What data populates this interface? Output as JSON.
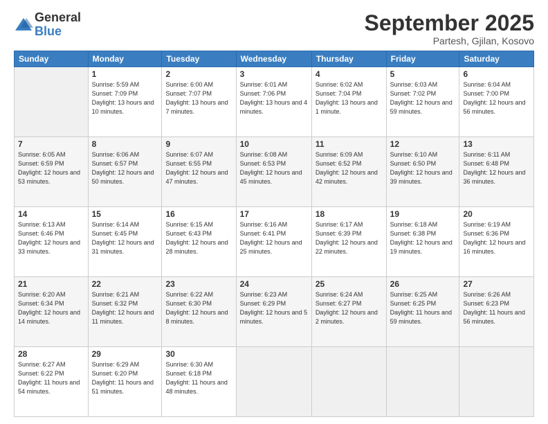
{
  "logo": {
    "general": "General",
    "blue": "Blue"
  },
  "title": "September 2025",
  "location": "Partesh, Gjilan, Kosovo",
  "days_of_week": [
    "Sunday",
    "Monday",
    "Tuesday",
    "Wednesday",
    "Thursday",
    "Friday",
    "Saturday"
  ],
  "weeks": [
    [
      {
        "day": "",
        "sunrise": "",
        "sunset": "",
        "daylight": ""
      },
      {
        "day": "1",
        "sunrise": "Sunrise: 5:59 AM",
        "sunset": "Sunset: 7:09 PM",
        "daylight": "Daylight: 13 hours and 10 minutes."
      },
      {
        "day": "2",
        "sunrise": "Sunrise: 6:00 AM",
        "sunset": "Sunset: 7:07 PM",
        "daylight": "Daylight: 13 hours and 7 minutes."
      },
      {
        "day": "3",
        "sunrise": "Sunrise: 6:01 AM",
        "sunset": "Sunset: 7:06 PM",
        "daylight": "Daylight: 13 hours and 4 minutes."
      },
      {
        "day": "4",
        "sunrise": "Sunrise: 6:02 AM",
        "sunset": "Sunset: 7:04 PM",
        "daylight": "Daylight: 13 hours and 1 minute."
      },
      {
        "day": "5",
        "sunrise": "Sunrise: 6:03 AM",
        "sunset": "Sunset: 7:02 PM",
        "daylight": "Daylight: 12 hours and 59 minutes."
      },
      {
        "day": "6",
        "sunrise": "Sunrise: 6:04 AM",
        "sunset": "Sunset: 7:00 PM",
        "daylight": "Daylight: 12 hours and 56 minutes."
      }
    ],
    [
      {
        "day": "7",
        "sunrise": "Sunrise: 6:05 AM",
        "sunset": "Sunset: 6:59 PM",
        "daylight": "Daylight: 12 hours and 53 minutes."
      },
      {
        "day": "8",
        "sunrise": "Sunrise: 6:06 AM",
        "sunset": "Sunset: 6:57 PM",
        "daylight": "Daylight: 12 hours and 50 minutes."
      },
      {
        "day": "9",
        "sunrise": "Sunrise: 6:07 AM",
        "sunset": "Sunset: 6:55 PM",
        "daylight": "Daylight: 12 hours and 47 minutes."
      },
      {
        "day": "10",
        "sunrise": "Sunrise: 6:08 AM",
        "sunset": "Sunset: 6:53 PM",
        "daylight": "Daylight: 12 hours and 45 minutes."
      },
      {
        "day": "11",
        "sunrise": "Sunrise: 6:09 AM",
        "sunset": "Sunset: 6:52 PM",
        "daylight": "Daylight: 12 hours and 42 minutes."
      },
      {
        "day": "12",
        "sunrise": "Sunrise: 6:10 AM",
        "sunset": "Sunset: 6:50 PM",
        "daylight": "Daylight: 12 hours and 39 minutes."
      },
      {
        "day": "13",
        "sunrise": "Sunrise: 6:11 AM",
        "sunset": "Sunset: 6:48 PM",
        "daylight": "Daylight: 12 hours and 36 minutes."
      }
    ],
    [
      {
        "day": "14",
        "sunrise": "Sunrise: 6:13 AM",
        "sunset": "Sunset: 6:46 PM",
        "daylight": "Daylight: 12 hours and 33 minutes."
      },
      {
        "day": "15",
        "sunrise": "Sunrise: 6:14 AM",
        "sunset": "Sunset: 6:45 PM",
        "daylight": "Daylight: 12 hours and 31 minutes."
      },
      {
        "day": "16",
        "sunrise": "Sunrise: 6:15 AM",
        "sunset": "Sunset: 6:43 PM",
        "daylight": "Daylight: 12 hours and 28 minutes."
      },
      {
        "day": "17",
        "sunrise": "Sunrise: 6:16 AM",
        "sunset": "Sunset: 6:41 PM",
        "daylight": "Daylight: 12 hours and 25 minutes."
      },
      {
        "day": "18",
        "sunrise": "Sunrise: 6:17 AM",
        "sunset": "Sunset: 6:39 PM",
        "daylight": "Daylight: 12 hours and 22 minutes."
      },
      {
        "day": "19",
        "sunrise": "Sunrise: 6:18 AM",
        "sunset": "Sunset: 6:38 PM",
        "daylight": "Daylight: 12 hours and 19 minutes."
      },
      {
        "day": "20",
        "sunrise": "Sunrise: 6:19 AM",
        "sunset": "Sunset: 6:36 PM",
        "daylight": "Daylight: 12 hours and 16 minutes."
      }
    ],
    [
      {
        "day": "21",
        "sunrise": "Sunrise: 6:20 AM",
        "sunset": "Sunset: 6:34 PM",
        "daylight": "Daylight: 12 hours and 14 minutes."
      },
      {
        "day": "22",
        "sunrise": "Sunrise: 6:21 AM",
        "sunset": "Sunset: 6:32 PM",
        "daylight": "Daylight: 12 hours and 11 minutes."
      },
      {
        "day": "23",
        "sunrise": "Sunrise: 6:22 AM",
        "sunset": "Sunset: 6:30 PM",
        "daylight": "Daylight: 12 hours and 8 minutes."
      },
      {
        "day": "24",
        "sunrise": "Sunrise: 6:23 AM",
        "sunset": "Sunset: 6:29 PM",
        "daylight": "Daylight: 12 hours and 5 minutes."
      },
      {
        "day": "25",
        "sunrise": "Sunrise: 6:24 AM",
        "sunset": "Sunset: 6:27 PM",
        "daylight": "Daylight: 12 hours and 2 minutes."
      },
      {
        "day": "26",
        "sunrise": "Sunrise: 6:25 AM",
        "sunset": "Sunset: 6:25 PM",
        "daylight": "Daylight: 11 hours and 59 minutes."
      },
      {
        "day": "27",
        "sunrise": "Sunrise: 6:26 AM",
        "sunset": "Sunset: 6:23 PM",
        "daylight": "Daylight: 11 hours and 56 minutes."
      }
    ],
    [
      {
        "day": "28",
        "sunrise": "Sunrise: 6:27 AM",
        "sunset": "Sunset: 6:22 PM",
        "daylight": "Daylight: 11 hours and 54 minutes."
      },
      {
        "day": "29",
        "sunrise": "Sunrise: 6:29 AM",
        "sunset": "Sunset: 6:20 PM",
        "daylight": "Daylight: 11 hours and 51 minutes."
      },
      {
        "day": "30",
        "sunrise": "Sunrise: 6:30 AM",
        "sunset": "Sunset: 6:18 PM",
        "daylight": "Daylight: 11 hours and 48 minutes."
      },
      {
        "day": "",
        "sunrise": "",
        "sunset": "",
        "daylight": ""
      },
      {
        "day": "",
        "sunrise": "",
        "sunset": "",
        "daylight": ""
      },
      {
        "day": "",
        "sunrise": "",
        "sunset": "",
        "daylight": ""
      },
      {
        "day": "",
        "sunrise": "",
        "sunset": "",
        "daylight": ""
      }
    ]
  ]
}
